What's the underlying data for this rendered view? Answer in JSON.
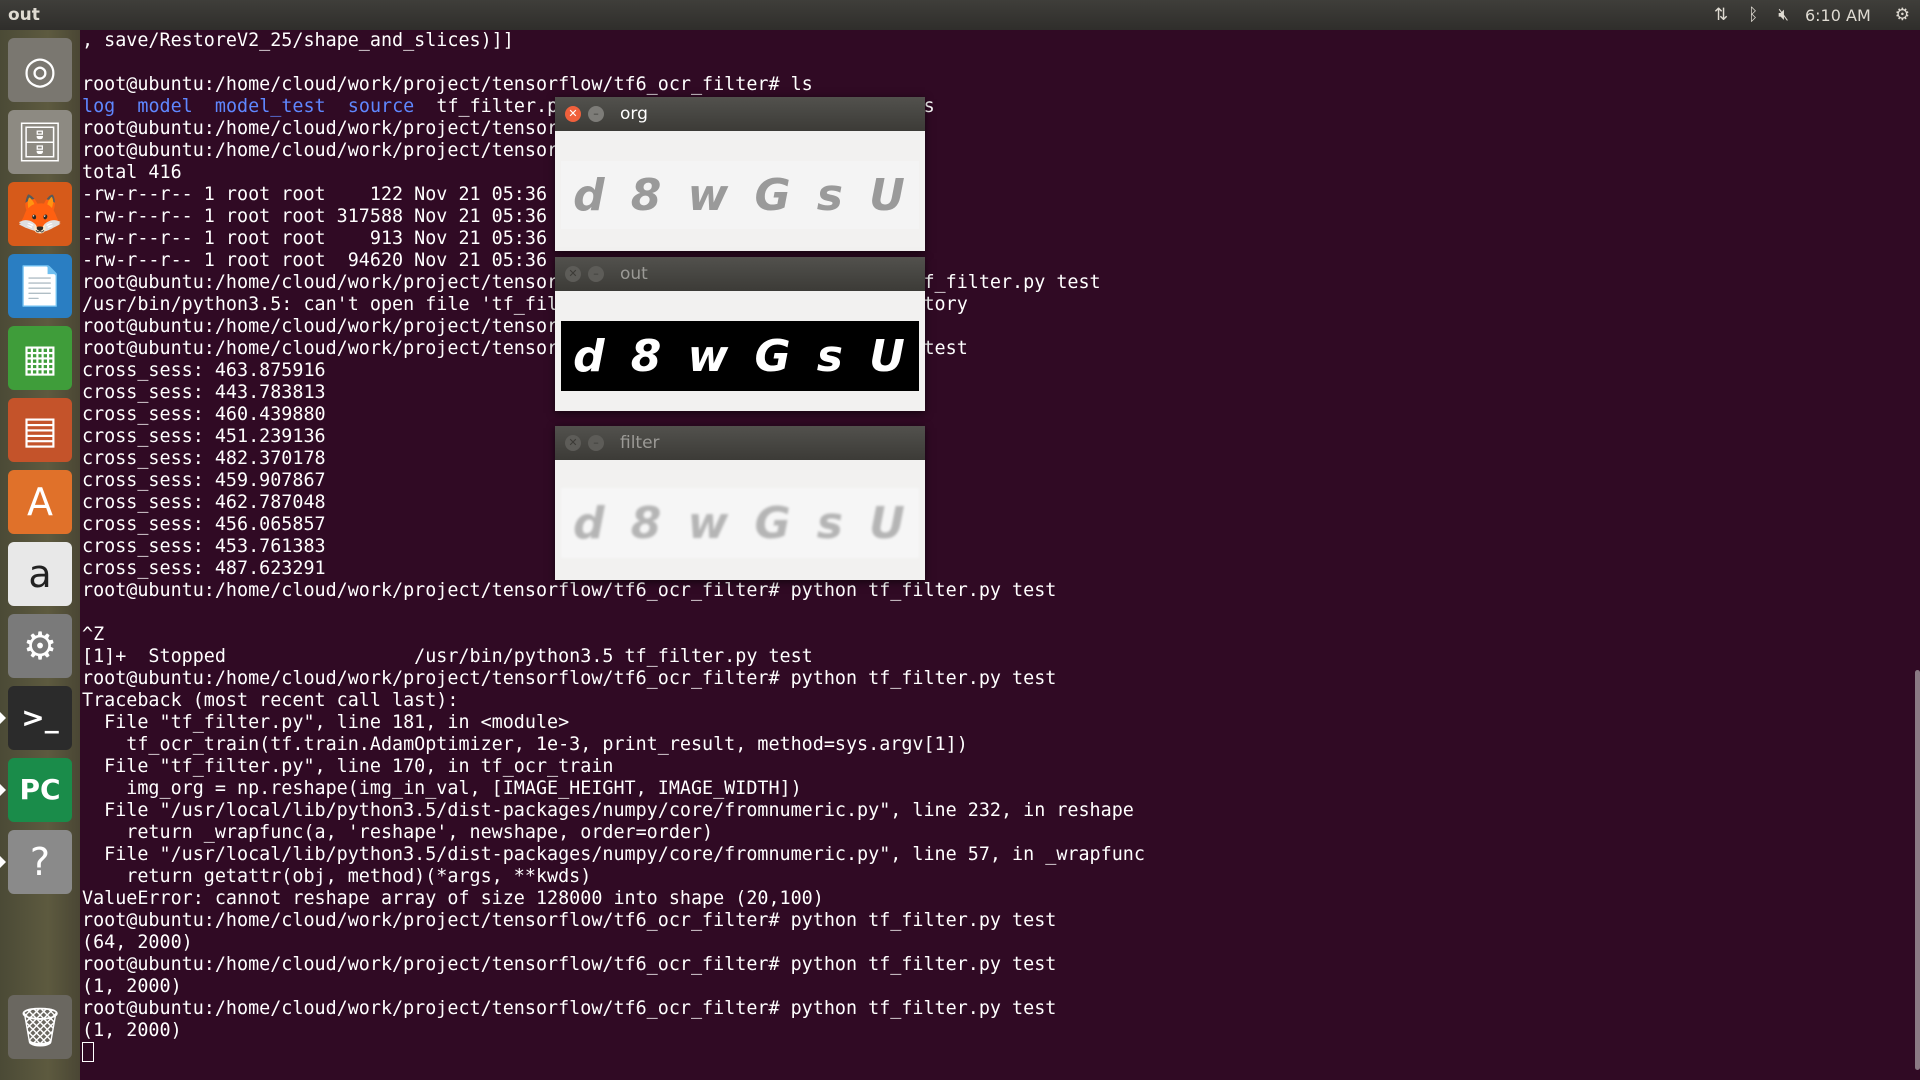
{
  "topbar": {
    "title": "out",
    "clock": "6:10 AM",
    "icons": [
      "network-arrows-icon",
      "bluetooth-icon",
      "volume-muted-icon",
      "settings-gear-icon"
    ]
  },
  "launcher": {
    "items": [
      {
        "name": "ubuntu-dash",
        "glyph": "◎"
      },
      {
        "name": "files",
        "glyph": "🗄"
      },
      {
        "name": "firefox",
        "glyph": "🦊"
      },
      {
        "name": "libreoffice-writer",
        "glyph": "📄"
      },
      {
        "name": "libreoffice-calc",
        "glyph": "▦"
      },
      {
        "name": "libreoffice-impress",
        "glyph": "▤"
      },
      {
        "name": "software-center",
        "glyph": "A"
      },
      {
        "name": "amazon",
        "glyph": "a"
      },
      {
        "name": "system-settings",
        "glyph": "⚙"
      },
      {
        "name": "terminal",
        "glyph": ">_"
      },
      {
        "name": "pycharm",
        "glyph": "PC"
      },
      {
        "name": "help",
        "glyph": "?"
      },
      {
        "name": "trash",
        "glyph": "🗑"
      }
    ]
  },
  "terminal": {
    "lines": [
      ", save/RestoreV2_25/shape_and_slices)]]",
      "",
      "root@ubuntu:/home/cloud/work/project/tensorflow/tf6_ocr_filter# ls",
      {
        "dirs": [
          "log",
          "model",
          "model_test",
          "source"
        ],
        "rest": "  tf_filter.p                       n.tfrecords"
      },
      "root@ubuntu:/home/cloud/work/project/tensor                          /",
      "root@ubuntu:/home/cloud/work/project/tensor                          s -l",
      "total 416",
      "-rw-r--r-- 1 root root    122 Nov 21 05:36",
      "-rw-r--r-- 1 root root 317588 Nov 21 05:36",
      "-rw-r--r-- 1 root root    913 Nov 21 05:36",
      "-rw-r--r-- 1 root root  94620 Nov 21 05:36",
      "root@ubuntu:/home/cloud/work/project/tensor                          ython tf_filter.py test",
      "/usr/bin/python3.5: can't open file 'tf_fil                          r directory",
      "root@ubuntu:/home/cloud/work/project/tensor                          ] ..",
      "root@ubuntu:/home/cloud/work/project/tensor                          ter.py test",
      "cross_sess: 463.875916",
      "cross_sess: 443.783813",
      "cross_sess: 460.439880",
      "cross_sess: 451.239136",
      "cross_sess: 482.370178",
      "cross_sess: 459.907867",
      "cross_sess: 462.787048",
      "cross_sess: 456.065857",
      "cross_sess: 453.761383",
      "cross_sess: 487.623291",
      "root@ubuntu:/home/cloud/work/project/tensorflow/tf6_ocr_filter# python tf_filter.py test",
      "",
      "^Z",
      "[1]+  Stopped                 /usr/bin/python3.5 tf_filter.py test",
      "root@ubuntu:/home/cloud/work/project/tensorflow/tf6_ocr_filter# python tf_filter.py test",
      "Traceback (most recent call last):",
      "  File \"tf_filter.py\", line 181, in <module>",
      "    tf_ocr_train(tf.train.AdamOptimizer, 1e-3, print_result, method=sys.argv[1])",
      "  File \"tf_filter.py\", line 170, in tf_ocr_train",
      "    img_org = np.reshape(img_in_val, [IMAGE_HEIGHT, IMAGE_WIDTH])",
      "  File \"/usr/local/lib/python3.5/dist-packages/numpy/core/fromnumeric.py\", line 232, in reshape",
      "    return _wrapfunc(a, 'reshape', newshape, order=order)",
      "  File \"/usr/local/lib/python3.5/dist-packages/numpy/core/fromnumeric.py\", line 57, in _wrapfunc",
      "    return getattr(obj, method)(*args, **kwds)",
      "ValueError: cannot reshape array of size 128000 into shape (20,100)",
      "root@ubuntu:/home/cloud/work/project/tensorflow/tf6_ocr_filter# python tf_filter.py test",
      "(64, 2000)",
      "root@ubuntu:/home/cloud/work/project/tensorflow/tf6_ocr_filter# python tf_filter.py test",
      "(1, 2000)",
      "root@ubuntu:/home/cloud/work/project/tensorflow/tf6_ocr_filter# python tf_filter.py test",
      "(1, 2000)"
    ]
  },
  "windows": {
    "org": {
      "title": "org",
      "captcha": [
        "d",
        "8",
        "w",
        "G",
        "s",
        "U"
      ]
    },
    "out": {
      "title": "out",
      "captcha": [
        "d",
        "8",
        "w",
        "G",
        "s",
        "U"
      ]
    },
    "filter": {
      "title": "filter",
      "captcha": [
        "d",
        "8",
        "w",
        "G",
        "s",
        "U"
      ]
    }
  },
  "colors": {
    "terminal_bg": "#300a24",
    "terminal_fg": "#ffffff",
    "dir_blue": "#5f87ff",
    "close_button": "#f0603c"
  }
}
